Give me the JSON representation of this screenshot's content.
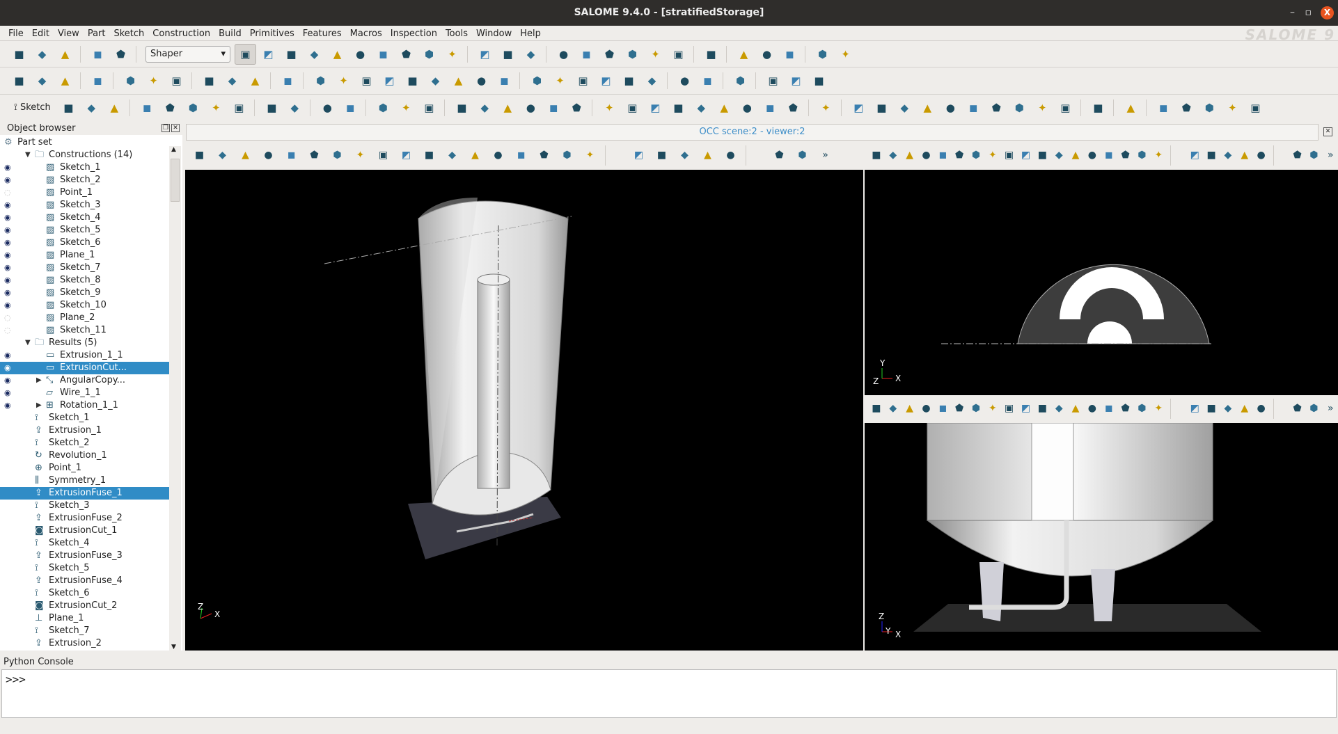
{
  "window": {
    "title": "SALOME  9.4.0 - [stratifiedStorage]",
    "minimize": "–",
    "maximize": "▫",
    "close": "X",
    "logo": "SALOME 9"
  },
  "menu": [
    "File",
    "Edit",
    "View",
    "Part",
    "Sketch",
    "Construction",
    "Build",
    "Primitives",
    "Features",
    "Macros",
    "Inspection",
    "Tools",
    "Window",
    "Help"
  ],
  "toolbar1": {
    "module": "Shaper",
    "icons": [
      "new-file",
      "open-folder",
      "save",
      "sep",
      "undo",
      "redo",
      "sep",
      "combo",
      "shaper-module",
      "geometry",
      "mesh",
      "paravis",
      "yacs",
      "jobmanager",
      "smesh-calc",
      "efcas",
      "homard",
      "fields",
      "sep",
      "preferences",
      "copy",
      "delete",
      "sep",
      "measure-a",
      "measure-b",
      "measure-c",
      "measure-d",
      "measure-e",
      "measure-f",
      "sep",
      "distance",
      "sep",
      "import",
      "export",
      "dump",
      "sep",
      "sum",
      "param-manager"
    ]
  },
  "toolbar2": {
    "icons": [
      "point",
      "axis",
      "plane",
      "sep",
      "part",
      "sep",
      "extrusion",
      "extrusion-cut",
      "extrusion-fuse",
      "sep",
      "revolution",
      "revolution-cut",
      "revolution-fuse",
      "sep",
      "pipe",
      "sep",
      "translate",
      "fuse",
      "common",
      "cut",
      "partition",
      "fillet",
      "chamfer",
      "split",
      "remove-subshapes",
      "sep",
      "angular-copy",
      "group",
      "sub-group",
      "group-add",
      "group-intersect",
      "group-subtract",
      "sep",
      "box",
      "cylinder",
      "sep",
      "smart-select",
      "sep",
      "point-cloud",
      "param-sum",
      "sketch-wire"
    ]
  },
  "toolbar3": {
    "sketch_label": "Sketch",
    "icons": [
      "sk-point",
      "sk-line",
      "sk-rect",
      "sep",
      "sk-circle",
      "sk-arc",
      "sk-arc-tangent",
      "sk-circle-3p",
      "sk-ellipse-arc",
      "sep",
      "sk-ellipse",
      "sk-ellipse-dash",
      "sep",
      "sk-projection",
      "sk-intersection",
      "sep",
      "sk-mirror",
      "sk-translate",
      "sk-rotate",
      "sep",
      "sk-horiz-dist",
      "sk-vert-dist",
      "sk-length",
      "sk-radius",
      "sk-angle",
      "sk-split",
      "sep",
      "sk-fixed",
      "sk-vertical",
      "sk-parallel",
      "sk-perpendicular",
      "sk-tangent",
      "sk-coincident",
      "sk-middle",
      "sk-equal",
      "sk-collinear",
      "sep",
      "whatsthis",
      "sep",
      "vertex",
      "edge",
      "wire",
      "polyline",
      "polygon",
      "face",
      "shell",
      "solid",
      "compsolid",
      "compound",
      "sep",
      "subshapes",
      "sep",
      "filling",
      "sep",
      "prim-box",
      "prim-cylinder",
      "prim-sphere",
      "prim-torus",
      "prim-cone"
    ]
  },
  "object_browser": {
    "title": "Object browser",
    "root": "Part set",
    "rows": [
      {
        "label": "Constructions (14)",
        "level": 1,
        "icon": "folder",
        "exp": "open"
      },
      {
        "label": "Sketch_1",
        "level": 2,
        "icon": "sketch",
        "eye": "on"
      },
      {
        "label": "Sketch_2",
        "level": 2,
        "icon": "sketch",
        "eye": "on"
      },
      {
        "label": "Point_1",
        "level": 2,
        "icon": "sketch",
        "eye": "off"
      },
      {
        "label": "Sketch_3",
        "level": 2,
        "icon": "sketch",
        "eye": "on"
      },
      {
        "label": "Sketch_4",
        "level": 2,
        "icon": "sketch",
        "eye": "on"
      },
      {
        "label": "Sketch_5",
        "level": 2,
        "icon": "sketch",
        "eye": "on"
      },
      {
        "label": "Sketch_6",
        "level": 2,
        "icon": "sketch",
        "eye": "on"
      },
      {
        "label": "Plane_1",
        "level": 2,
        "icon": "sketch",
        "eye": "on"
      },
      {
        "label": "Sketch_7",
        "level": 2,
        "icon": "sketch",
        "eye": "on"
      },
      {
        "label": "Sketch_8",
        "level": 2,
        "icon": "sketch",
        "eye": "on"
      },
      {
        "label": "Sketch_9",
        "level": 2,
        "icon": "sketch",
        "eye": "on"
      },
      {
        "label": "Sketch_10",
        "level": 2,
        "icon": "sketch",
        "eye": "on"
      },
      {
        "label": "Plane_2",
        "level": 2,
        "icon": "sketch",
        "eye": "off"
      },
      {
        "label": "Sketch_11",
        "level": 2,
        "icon": "sketch",
        "eye": "off"
      },
      {
        "label": "Results (5)",
        "level": 1,
        "icon": "folder",
        "exp": "open"
      },
      {
        "label": "Extrusion_1_1",
        "level": 2,
        "icon": "solid",
        "eye": "on"
      },
      {
        "label": "ExtrusionCut...",
        "level": 2,
        "icon": "solid",
        "eye": "on",
        "selected": true
      },
      {
        "label": "AngularCopy...",
        "level": 2,
        "icon": "angular-copy",
        "eye": "on",
        "exp": "closed"
      },
      {
        "label": "Wire_1_1",
        "level": 2,
        "icon": "wire",
        "eye": "on"
      },
      {
        "label": "Rotation_1_1",
        "level": 2,
        "icon": "rotation",
        "eye": "on",
        "exp": "closed"
      },
      {
        "label": "Sketch_1",
        "level": 1,
        "icon": "sketch-feature"
      },
      {
        "label": "Extrusion_1",
        "level": 1,
        "icon": "extrusion"
      },
      {
        "label": "Sketch_2",
        "level": 1,
        "icon": "sketch-feature"
      },
      {
        "label": "Revolution_1",
        "level": 1,
        "icon": "revolution"
      },
      {
        "label": "Point_1",
        "level": 1,
        "icon": "point"
      },
      {
        "label": "Symmetry_1",
        "level": 1,
        "icon": "symmetry"
      },
      {
        "label": "ExtrusionFuse_1",
        "level": 1,
        "icon": "extrusion-fuse",
        "selected": true
      },
      {
        "label": "Sketch_3",
        "level": 1,
        "icon": "sketch-feature"
      },
      {
        "label": "ExtrusionFuse_2",
        "level": 1,
        "icon": "extrusion-fuse"
      },
      {
        "label": "ExtrusionCut_1",
        "level": 1,
        "icon": "extrusion-cut"
      },
      {
        "label": "Sketch_4",
        "level": 1,
        "icon": "sketch-feature"
      },
      {
        "label": "ExtrusionFuse_3",
        "level": 1,
        "icon": "extrusion-fuse"
      },
      {
        "label": "Sketch_5",
        "level": 1,
        "icon": "sketch-feature"
      },
      {
        "label": "ExtrusionFuse_4",
        "level": 1,
        "icon": "extrusion-fuse"
      },
      {
        "label": "Sketch_6",
        "level": 1,
        "icon": "sketch-feature"
      },
      {
        "label": "ExtrusionCut_2",
        "level": 1,
        "icon": "extrusion-cut"
      },
      {
        "label": "Plane_1",
        "level": 1,
        "icon": "plane"
      },
      {
        "label": "Sketch_7",
        "level": 1,
        "icon": "sketch-feature"
      },
      {
        "label": "Extrusion_2",
        "level": 1,
        "icon": "extrusion"
      }
    ]
  },
  "viewer": {
    "scene_title": "OCC scene:2 - viewer:2",
    "more": "»",
    "toolbar_icons": [
      "dump-view",
      "interaction-style",
      "zoom-style",
      "rect-select",
      "poly-select",
      "polygon-select",
      "circle-select",
      "trihedron",
      "zoom",
      "pan",
      "global-pan",
      "rotate",
      "rotation-point",
      "fit-all",
      "fit-area",
      "fit-selection",
      "zoom-to-sel",
      "clone-view",
      "sep",
      "clipping",
      "shoot-view",
      "ray-tracing",
      "env-texture",
      "light",
      "sep",
      "axo",
      "sync"
    ],
    "axes": {
      "x": "X",
      "y": "Y",
      "z": "Z"
    }
  },
  "console": {
    "title": "Python Console",
    "prompt": ">>>"
  }
}
